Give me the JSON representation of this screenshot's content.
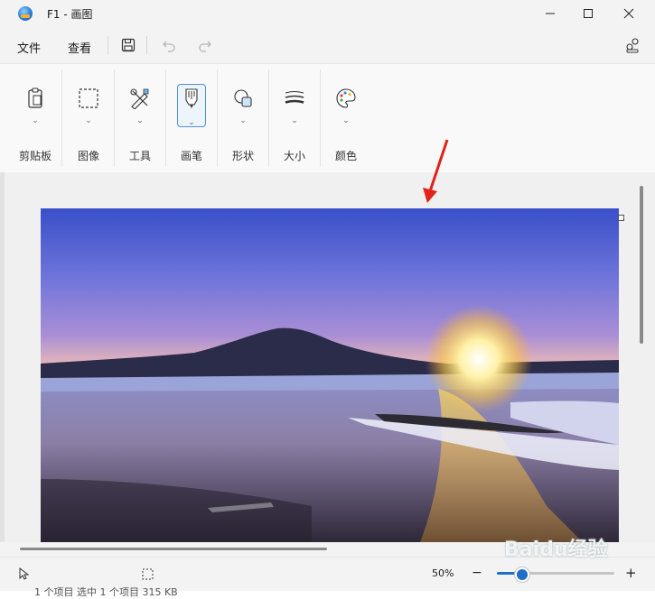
{
  "window": {
    "title": "F1 - 画图"
  },
  "menu": {
    "file": "文件",
    "view": "查看"
  },
  "ribbon": {
    "groups": [
      {
        "label": "剪贴板",
        "icon": "clipboard-icon"
      },
      {
        "label": "图像",
        "icon": "selection-icon"
      },
      {
        "label": "工具",
        "icon": "tools-icon"
      },
      {
        "label": "画笔",
        "icon": "brush-icon"
      },
      {
        "label": "形状",
        "icon": "shapes-icon"
      },
      {
        "label": "大小",
        "icon": "stroke-size-icon"
      },
      {
        "label": "颜色",
        "icon": "palette-icon"
      }
    ]
  },
  "status": {
    "zoom": "50%",
    "zoom_level": 0.2,
    "info": "1 个项目    选中 1 个项目 315 KB"
  },
  "watermark": "Baidu经验",
  "colors": {
    "accent": "#1f6fc9",
    "annotation_arrow": "#e0231b"
  }
}
